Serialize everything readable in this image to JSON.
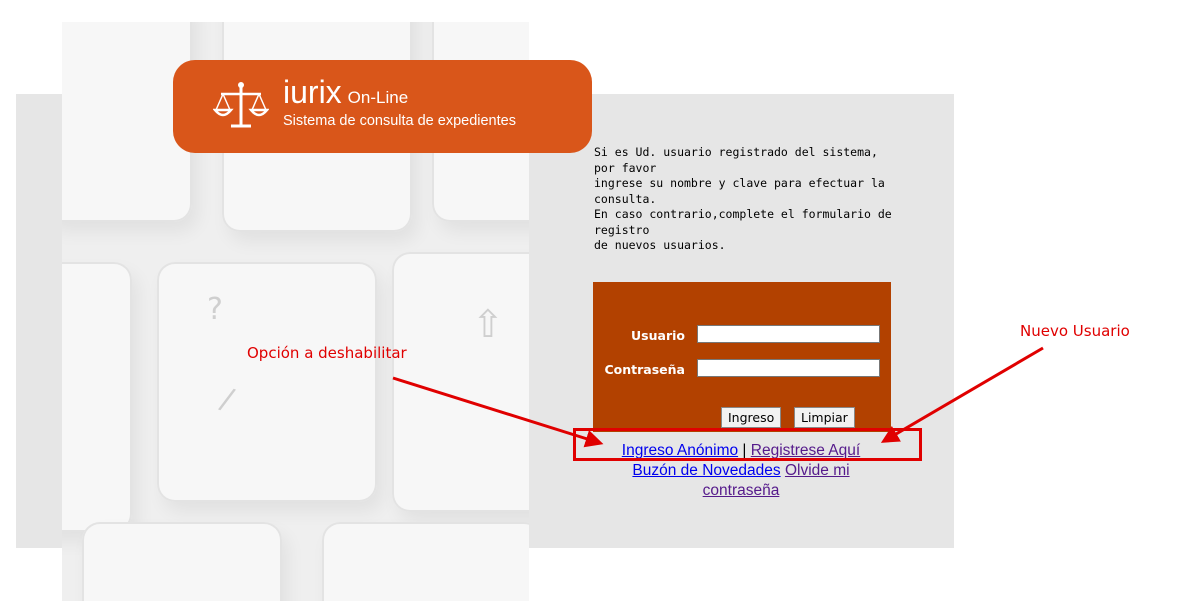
{
  "logo": {
    "brand": "iurix",
    "brand_suffix": "On-Line",
    "subtitle": "Sistema de consulta de expedientes",
    "icon": "scales-of-justice-icon",
    "color": "#d9561a"
  },
  "intro": {
    "lines": [
      "Si es Ud. usuario registrado del sistema,",
      "por favor",
      "ingrese su nombre y clave para efectuar la",
      "consulta.",
      "En caso contrario,complete el formulario de",
      "registro",
      "de nuevos usuarios."
    ]
  },
  "login": {
    "user_label": "Usuario",
    "user_value": "",
    "password_label": "Contraseña",
    "password_value": "",
    "submit_label": "Ingreso",
    "clear_label": "Limpiar",
    "panel_color": "#b24100"
  },
  "links": {
    "anonymous": "Ingreso Anónimo",
    "separator": "|",
    "register": "Registrese Aquí",
    "news": "Buzón de Novedades",
    "forgot": "Olvide mi contraseña"
  },
  "annotations": {
    "disable_label": "Opción a deshabilitar",
    "new_user_label": "Nuevo Usuario",
    "color": "#e00000"
  }
}
